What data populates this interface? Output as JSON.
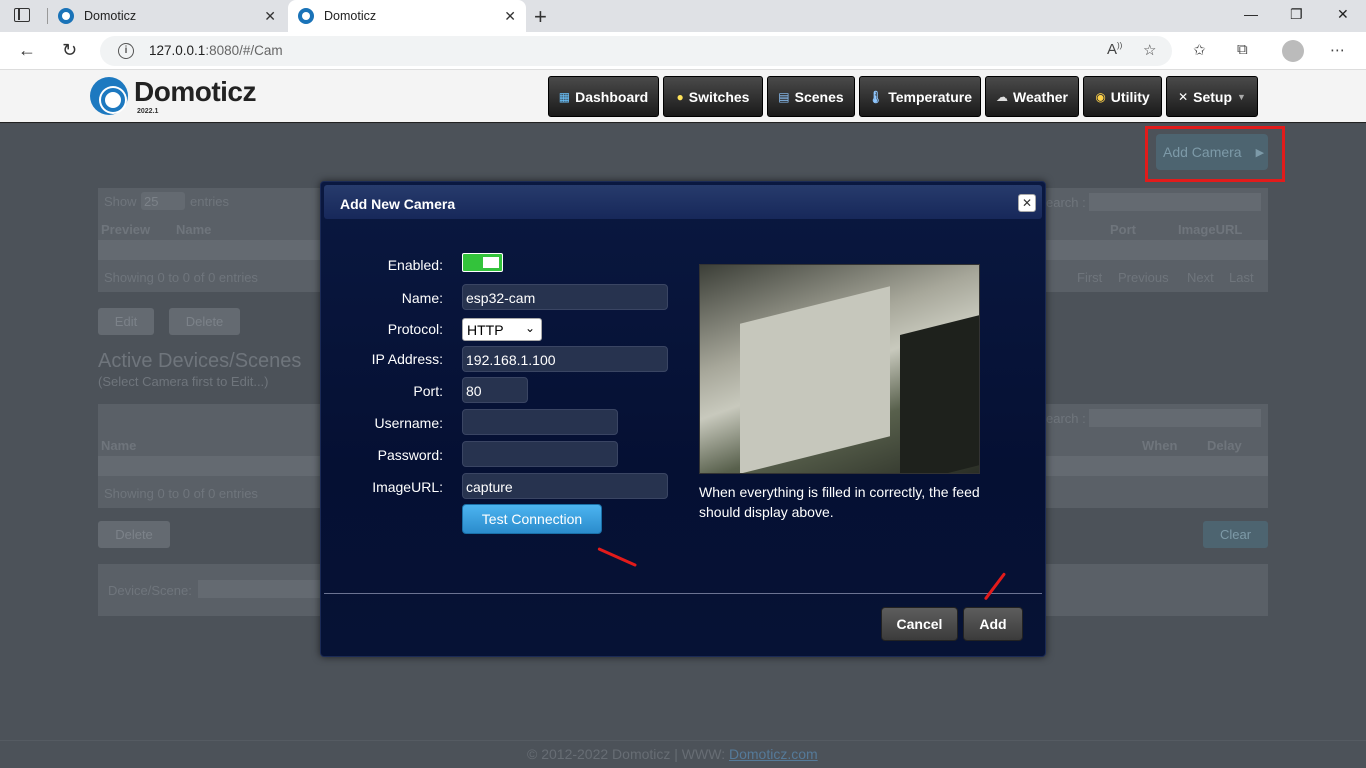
{
  "browser": {
    "tabs": [
      {
        "title": "Domoticz",
        "active": false
      },
      {
        "title": "Domoticz",
        "active": true
      }
    ],
    "url_host": "127.0.0.1",
    "url_rest": ":8080/#/Cam"
  },
  "header": {
    "logo_text": "Domoticz",
    "version": "2022.1",
    "nav": [
      {
        "label": "Dashboard",
        "icon": "dashboard-icon"
      },
      {
        "label": "Switches",
        "icon": "bulb-icon"
      },
      {
        "label": "Scenes",
        "icon": "clapper-icon"
      },
      {
        "label": "Temperature",
        "icon": "thermometer-icon"
      },
      {
        "label": "Weather",
        "icon": "cloud-icon"
      },
      {
        "label": "Utility",
        "icon": "utility-icon"
      },
      {
        "label": "Setup",
        "icon": "tools-icon"
      }
    ]
  },
  "background": {
    "add_camera": "Add Camera",
    "show": "Show",
    "page_size": "25",
    "entries": "entries",
    "search": "earch :",
    "cols_top": {
      "preview": "Preview",
      "name": "Name",
      "port": "Port",
      "imageurl": "ImageURL"
    },
    "showing": "Showing 0 to 0 of 0 entries",
    "pager": {
      "first": "First",
      "previous": "Previous",
      "next": "Next",
      "last": "Last"
    },
    "edit": "Edit",
    "delete": "Delete",
    "section_title": "Active Devices/Scenes",
    "section_sub": "(Select Camera first to Edit...)",
    "cols_bottom": {
      "name": "Name",
      "when": "When",
      "delay": "Delay"
    },
    "clear": "Clear",
    "device_scene": "Device/Scene:",
    "footer_prefix": "© 2012-2022 Domoticz | WWW: ",
    "footer_link": "Domoticz.com"
  },
  "dialog": {
    "title": "Add New Camera",
    "labels": {
      "enabled": "Enabled:",
      "name": "Name:",
      "protocol": "Protocol:",
      "ip": "IP Address:",
      "port": "Port:",
      "username": "Username:",
      "password": "Password:",
      "imageurl": "ImageURL:"
    },
    "values": {
      "enabled": true,
      "name": "esp32-cam",
      "protocol": "HTTP",
      "ip": "192.168.1.100",
      "port": "80",
      "username": "",
      "password": "",
      "imageurl": "capture"
    },
    "test_button": "Test Connection",
    "feed_note": "When everything is filled in correctly, the feed should display above.",
    "cancel": "Cancel",
    "add": "Add"
  }
}
